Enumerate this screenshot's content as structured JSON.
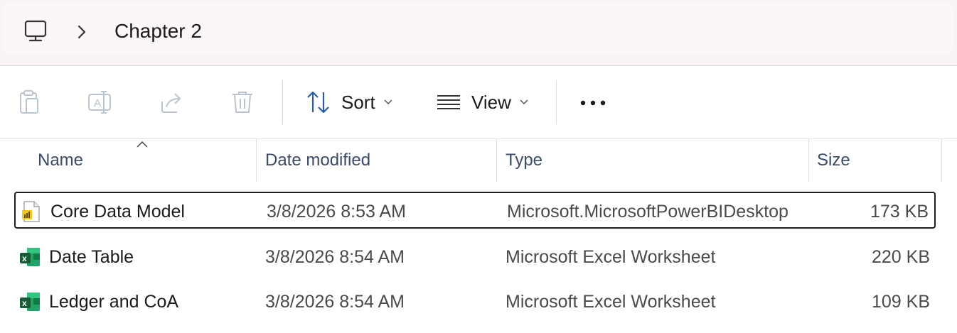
{
  "breadcrumb": {
    "root_icon": "computer-icon",
    "separator_icon": "chevron-right-icon",
    "current": "Chapter 2"
  },
  "toolbar": {
    "paste_icon": "paste-icon",
    "rename_icon": "rename-icon",
    "share_icon": "share-icon",
    "delete_icon": "delete-icon",
    "sort_label": "Sort",
    "view_label": "View",
    "more_icon": "more-options-icon"
  },
  "columns": {
    "name": "Name",
    "date_modified": "Date modified",
    "type": "Type",
    "size": "Size"
  },
  "files": [
    {
      "name": "Core Data Model",
      "date": "3/8/2026 8:53 AM",
      "type": "Microsoft.MicrosoftPowerBIDesktop",
      "size": "173 KB",
      "icon": "powerbi-file-icon",
      "selected": true
    },
    {
      "name": "Date Table",
      "date": "3/8/2026 8:54 AM",
      "type": "Microsoft Excel Worksheet",
      "size": "220 KB",
      "icon": "excel-file-icon",
      "selected": false
    },
    {
      "name": "Ledger and CoA",
      "date": "3/8/2026 8:54 AM",
      "type": "Microsoft Excel Worksheet",
      "size": "109 KB",
      "icon": "excel-file-icon",
      "selected": false
    }
  ],
  "colors": {
    "address_bg": "#fcf6f6",
    "excel_green": "#1d7044",
    "powerbi_yellow": "#f2c811",
    "disabled_icon": "#b8c4d0"
  }
}
